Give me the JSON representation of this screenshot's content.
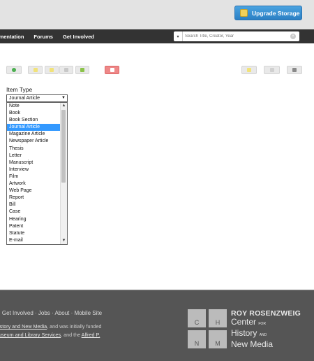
{
  "header": {
    "upgrade_label": "Upgrade Storage"
  },
  "nav": {
    "links": [
      "umentation",
      "Forums",
      "Get Involved"
    ],
    "search_placeholder": "Search Title, Creator, Year"
  },
  "item_type": {
    "label": "Item Type",
    "selected": "Journal Article",
    "options": [
      "Note",
      "Book",
      "Book Section",
      "Journal Article",
      "Magazine Article",
      "Newspaper Article",
      "Thesis",
      "Letter",
      "Manuscript",
      "Interview",
      "Film",
      "Artwork",
      "Web Page",
      "Report",
      "Bill",
      "Case",
      "Hearing",
      "Patent",
      "Statute",
      "E-mail"
    ],
    "highlighted_index": 3
  },
  "footer": {
    "links_text": "· Get Involved · Jobs · About · Mobile Site",
    "line1_link": "istory and New Media",
    "line1_rest": ", and was initially funded",
    "line2_link": "useum and Library Services",
    "line2_mid": ", and the ",
    "line2_link2": "Alfred P.",
    "logo_letters": [
      "C",
      "H",
      "N",
      "M"
    ],
    "org_line1": "ROY ROSENZWEIG",
    "org_line2": "Center",
    "org_line2_small": "FOR",
    "org_line3": "History",
    "org_line3_small": "AND",
    "org_line4": "New Media"
  },
  "colors": {
    "accent": "#3399ff",
    "upgrade": "#2b7fc4",
    "navbar": "#333333",
    "footer": "#555555"
  }
}
